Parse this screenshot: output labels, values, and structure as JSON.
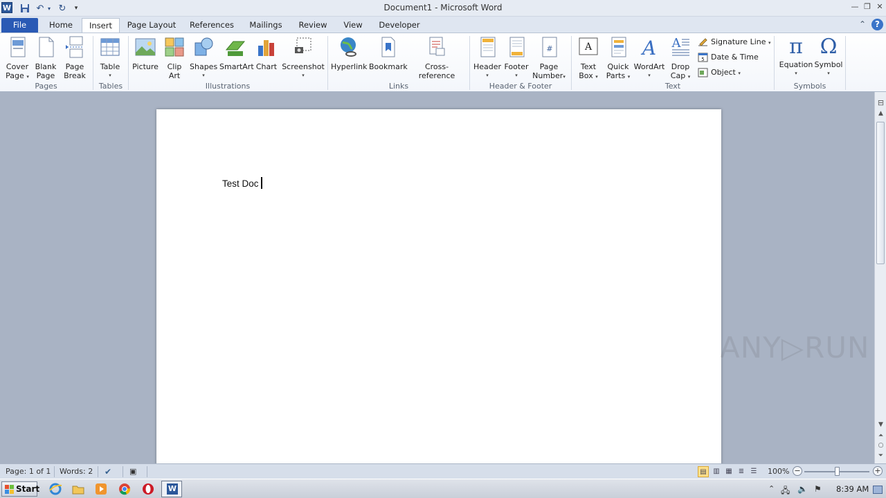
{
  "window": {
    "title": "Document1 - Microsoft Word",
    "app_icon": "W"
  },
  "tabs": [
    {
      "label": "File"
    },
    {
      "label": "Home"
    },
    {
      "label": "Insert"
    },
    {
      "label": "Page Layout"
    },
    {
      "label": "References"
    },
    {
      "label": "Mailings"
    },
    {
      "label": "Review"
    },
    {
      "label": "View"
    },
    {
      "label": "Developer"
    }
  ],
  "active_tab": "Insert",
  "ribbon": {
    "pages": {
      "label": "Pages",
      "cover_page": [
        "Cover",
        "Page"
      ],
      "blank_page": [
        "Blank",
        "Page"
      ],
      "page_break": [
        "Page",
        "Break"
      ]
    },
    "tables": {
      "label": "Tables",
      "table": "Table"
    },
    "illustrations": {
      "label": "Illustrations",
      "picture": "Picture",
      "clip_art": [
        "Clip",
        "Art"
      ],
      "shapes": "Shapes",
      "smartart": "SmartArt",
      "chart": "Chart",
      "screenshot": "Screenshot"
    },
    "links": {
      "label": "Links",
      "hyperlink": "Hyperlink",
      "bookmark": "Bookmark",
      "cross_reference": "Cross-reference"
    },
    "header_footer": {
      "label": "Header & Footer",
      "header": "Header",
      "footer": "Footer",
      "page_number": [
        "Page",
        "Number"
      ]
    },
    "text": {
      "label": "Text",
      "text_box": [
        "Text",
        "Box"
      ],
      "quick_parts": [
        "Quick",
        "Parts"
      ],
      "wordart": "WordArt",
      "drop_cap": [
        "Drop",
        "Cap"
      ],
      "signature_line": "Signature Line",
      "date_time": "Date & Time",
      "object": "Object"
    },
    "symbols": {
      "label": "Symbols",
      "equation": "Equation",
      "symbol": "Symbol",
      "equation_glyph": "π",
      "symbol_glyph": "Ω"
    }
  },
  "document": {
    "text": "Test Doc"
  },
  "watermark": "ANY▷RUN",
  "statusbar": {
    "page": "Page: 1 of 1",
    "words": "Words: 2",
    "zoom": "100%",
    "zoom_level": 1.0
  },
  "taskbar": {
    "start": "Start",
    "clock": "8:39 AM"
  },
  "colors": {
    "file_tab": "#2a5ab5",
    "doc_background": "#a9b3c4",
    "ribbon": "#ffffff"
  }
}
